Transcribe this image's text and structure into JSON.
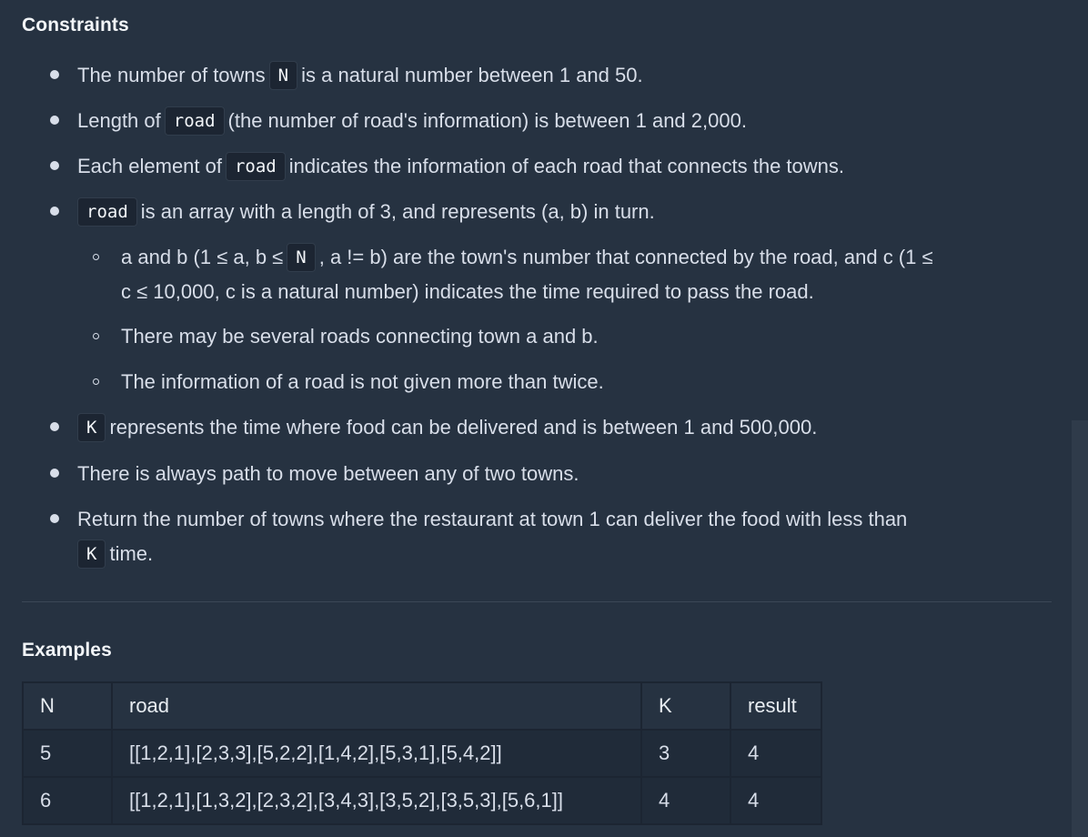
{
  "constraints": {
    "heading": "Constraints",
    "items": {
      "i1": {
        "a": "The number of towns",
        "code": "N",
        "b": "is a natural number between 1 and 50."
      },
      "i2": {
        "a": "Length of",
        "code": "road",
        "b": "(the number of road's information) is between 1 and 2,000."
      },
      "i3": {
        "a": "Each element of",
        "code": "road",
        "b": "indicates the information of each road that connects the towns."
      },
      "i4": {
        "code": "road",
        "b": "is an array with a length of 3, and represents (a, b) in turn."
      },
      "s1": {
        "a": "a and b (1 ≤ a, b ≤",
        "code": "N",
        "b": ", a != b) are the town's number that connected by the road, and c (1 ≤",
        "c": "c ≤ 10,000, c is a natural number) indicates the time required to pass the road."
      },
      "s2": {
        "a": "There may be several roads connecting town a and b."
      },
      "s3": {
        "a": "The information of a road is not given more than twice."
      },
      "i5": {
        "code": "K",
        "b": "represents the time where food can be delivered and is between 1 and 500,000."
      },
      "i6": {
        "a": "There is always path to move between any of two towns."
      },
      "i7": {
        "a": "Return the number of towns where the restaurant at town 1 can deliver the food with less than",
        "code": "K",
        "b": "time."
      }
    }
  },
  "examples": {
    "heading": "Examples",
    "headers": {
      "n": "N",
      "road": "road",
      "k": "K",
      "result": "result"
    },
    "rows": [
      {
        "n": "5",
        "road": "[[1,2,1],[2,3,3],[5,2,2],[1,4,2],[5,3,1],[5,4,2]]",
        "k": "3",
        "result": "4"
      },
      {
        "n": "6",
        "road": "[[1,2,1],[1,3,2],[2,3,2],[3,4,3],[3,5,2],[3,5,3],[5,6,1]]",
        "k": "4",
        "result": "4"
      }
    ]
  },
  "colors": {
    "background": "#263241",
    "code_background": "#1c2532",
    "table_row": "#202b39",
    "text": "#d8dee9"
  }
}
